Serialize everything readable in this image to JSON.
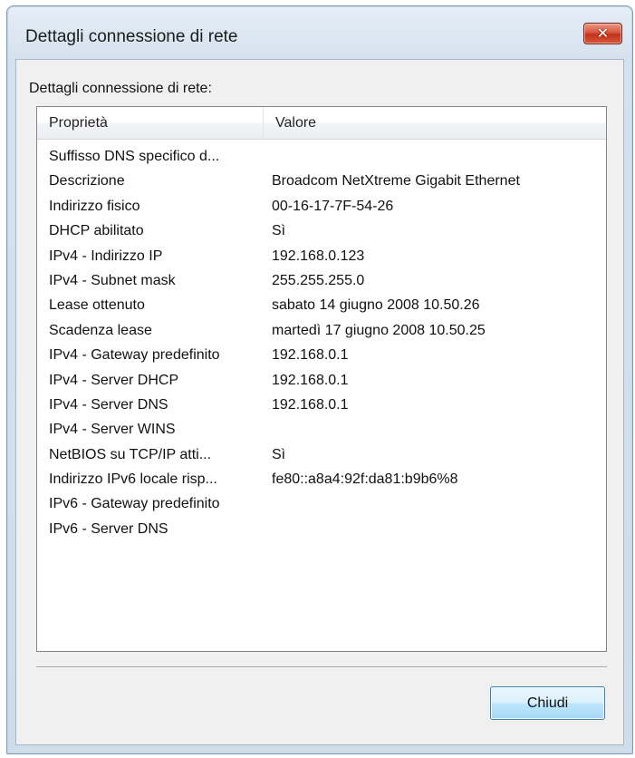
{
  "window": {
    "title": "Dettagli connessione di rete",
    "close_glyph": "✕"
  },
  "group_label": "Dettagli connessione di rete:",
  "list": {
    "columns": [
      "Proprietà",
      "Valore"
    ],
    "rows": [
      {
        "property": "Suffisso DNS specifico d...",
        "value": ""
      },
      {
        "property": "Descrizione",
        "value": "Broadcom NetXtreme Gigabit Ethernet"
      },
      {
        "property": "Indirizzo fisico",
        "value": "00-16-17-7F-54-26"
      },
      {
        "property": "DHCP abilitato",
        "value": "Sì"
      },
      {
        "property": "IPv4 - Indirizzo IP",
        "value": "192.168.0.123"
      },
      {
        "property": "IPv4 - Subnet mask",
        "value": "255.255.255.0"
      },
      {
        "property": "Lease ottenuto",
        "value": "sabato 14 giugno 2008 10.50.26"
      },
      {
        "property": "Scadenza lease",
        "value": "martedì 17 giugno 2008 10.50.25"
      },
      {
        "property": "IPv4 - Gateway predefinito",
        "value": "192.168.0.1"
      },
      {
        "property": "IPv4 - Server DHCP",
        "value": "192.168.0.1"
      },
      {
        "property": "IPv4 - Server DNS",
        "value": "192.168.0.1"
      },
      {
        "property": "IPv4 - Server WINS",
        "value": ""
      },
      {
        "property": "NetBIOS su TCP/IP atti...",
        "value": "Sì"
      },
      {
        "property": "Indirizzo IPv6 locale risp...",
        "value": "fe80::a8a4:92f:da81:b9b6%8"
      },
      {
        "property": "IPv6 - Gateway predefinito",
        "value": ""
      },
      {
        "property": "IPv6 - Server DNS",
        "value": ""
      }
    ]
  },
  "buttons": {
    "close_label": "Chiudi"
  }
}
